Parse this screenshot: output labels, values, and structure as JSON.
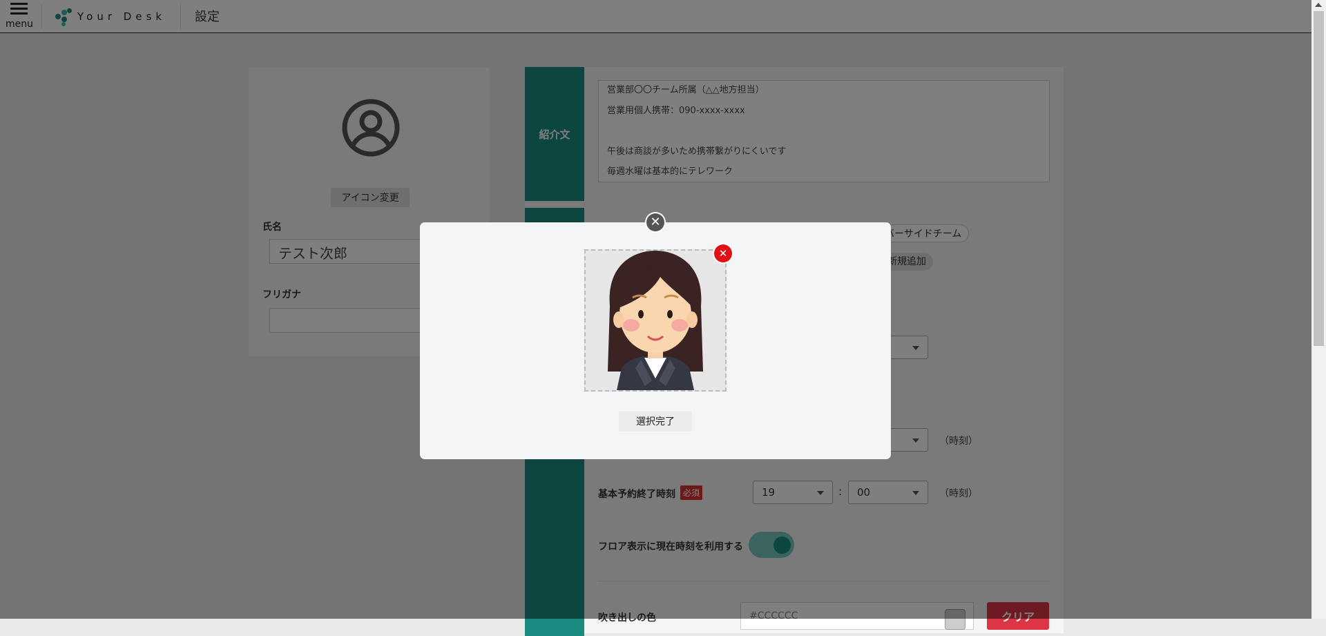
{
  "header": {
    "menu_label": "menu",
    "brand": "Your Desk",
    "page_title": "設定"
  },
  "profile": {
    "change_icon_label": "アイコン変更",
    "name_label": "氏名",
    "name_value": "テスト次郎",
    "furigana_label": "フリガナ",
    "furigana_value": ""
  },
  "intro": {
    "section_label": "紹介文",
    "lines": [
      "営業部〇〇チーム所属（△△地方担当）",
      "営業用個人携帯：090-xxxx-xxxx",
      "",
      "午後は商談が多いため携帯繋がりにくいです",
      "毎週水曜は基本的にテレワーク"
    ]
  },
  "teams": {
    "team_chip": "バーサイドチーム",
    "add_chip": "新規追加"
  },
  "schedule": {
    "time_unit": "（時刻）",
    "end_label": "基本予約終了時刻",
    "required_badge": "必須",
    "end_hour": "19",
    "end_minute": "00",
    "colon": ":",
    "floor_time_label": "フロア表示に現在時刻を利用する",
    "floor_time_enabled": true,
    "bubble_color_label": "吹き出しの色",
    "bubble_color_value": "#CCCCCC",
    "clear_label": "クリア"
  },
  "modal": {
    "close_glyph": "✕",
    "remove_glyph": "✕",
    "done_label": "選択完了"
  },
  "colors": {
    "accent": "#1b8b80",
    "danger": "#e10f16",
    "required": "#dd3333"
  }
}
